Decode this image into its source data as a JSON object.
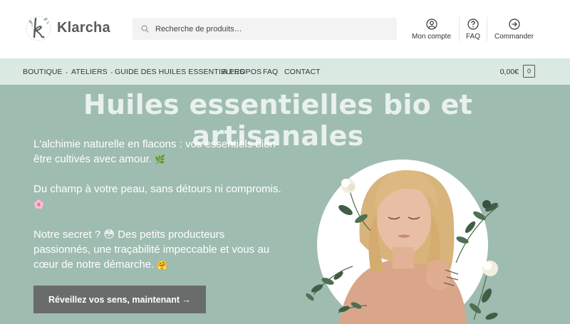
{
  "brand": {
    "name": "Klarcha",
    "mark_letter": "k."
  },
  "search": {
    "placeholder": "Recherche de produits…",
    "icon": "search-icon"
  },
  "header_links": [
    {
      "label": "Mon compte",
      "icon": "user-circle-icon"
    },
    {
      "label": "FAQ",
      "icon": "question-circle-icon"
    },
    {
      "label": "Commander",
      "icon": "arrow-circle-right-icon"
    }
  ],
  "nav": {
    "items": [
      {
        "label": "BOUTIQUE",
        "has_dropdown": true
      },
      {
        "label": "ATELIERS",
        "has_dropdown": true
      },
      {
        "label": "GUIDE DES HUILES ESSENTIELLES",
        "has_dropdown": false
      },
      {
        "label": "A PROPOS",
        "has_dropdown": false
      },
      {
        "label": "FAQ",
        "has_dropdown": false
      },
      {
        "label": "CONTACT",
        "has_dropdown": false
      }
    ],
    "cart_total": "0,00€",
    "cart_count": "0"
  },
  "hero": {
    "title": "Huiles essentielles bio et artisanales",
    "paragraphs": [
      {
        "text": "L'alchimie naturelle en flacons : vos essentiels bien-être cultivés avec amour.",
        "emoji": "🌿"
      },
      {
        "text": "Du champ à votre peau, sans détours ni compromis.",
        "emoji": "🌸"
      },
      {
        "text": "Notre secret ? 😳 Des petits producteurs passionnés, une traçabilité impeccable et vous au cœur de notre démarche.",
        "emoji": "🤗"
      }
    ],
    "cta_label": "Réveillez vos sens, maintenant →"
  },
  "colors": {
    "nav_bg": "#dbe9e3",
    "hero_bg": "#9fbcb1",
    "hero_title": "#e9f1ed",
    "cta_bg": "#6a6b6b",
    "search_bg": "#f3f3f3"
  }
}
